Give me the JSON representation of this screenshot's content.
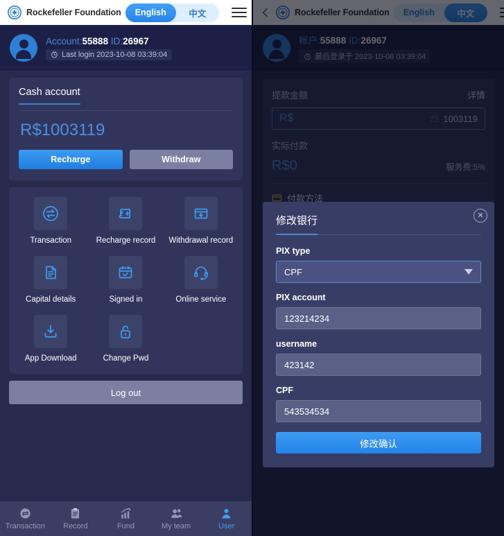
{
  "colors": {
    "panel_bg": "#272a4d",
    "card_bg": "#31355c",
    "accent_blue": "#3d9bf2",
    "text_blue": "#4d8fe0",
    "muted": "#7b80a3",
    "modal_bg": "#383d66"
  },
  "left": {
    "topbar": {
      "brand": "Rockefeller Foundation",
      "logo_icon": "compass-badge-icon",
      "languages": [
        {
          "label": "English",
          "active": true
        },
        {
          "label": "中文",
          "active": false
        }
      ],
      "menu_icon": "hamburger-icon"
    },
    "account": {
      "avatar_icon": "user-avatar-icon",
      "account_label": "Account:",
      "account_value": "55888",
      "id_label": "ID:",
      "id_value": "26967",
      "clock_icon": "clock-icon",
      "last_login": "Last login 2023-10-08 03:39:04"
    },
    "cash_card": {
      "title": "Cash account",
      "balance": "R$1003119",
      "recharge_label": "Recharge",
      "withdraw_label": "Withdraw"
    },
    "grid": [
      {
        "label": "Transaction",
        "icon": "exchange-circle-icon"
      },
      {
        "label": "Recharge record",
        "icon": "wallet-in-icon"
      },
      {
        "label": "Withdrawal record",
        "icon": "card-down-icon"
      },
      {
        "label": "Capital details",
        "icon": "document-lines-icon"
      },
      {
        "label": "Signed in",
        "icon": "calendar-check-icon"
      },
      {
        "label": "Online service",
        "icon": "headset-icon"
      },
      {
        "label": "App Download",
        "icon": "download-tray-icon"
      },
      {
        "label": "Change Pwd",
        "icon": "open-padlock-icon"
      }
    ],
    "logout_label": "Log out",
    "bottom_nav": [
      {
        "label": "Transaction",
        "icon": "exchange-circle-icon",
        "active": false
      },
      {
        "label": "Record",
        "icon": "clipboard-icon",
        "active": false
      },
      {
        "label": "Fund",
        "icon": "bar-chart-up-icon",
        "active": false
      },
      {
        "label": "My team",
        "icon": "people-icon",
        "active": false
      },
      {
        "label": "User",
        "icon": "person-icon",
        "active": true
      }
    ]
  },
  "right": {
    "topbar": {
      "back_icon": "chevron-left-icon",
      "brand": "Rockefeller Foundation",
      "logo_icon": "compass-badge-icon",
      "languages": [
        {
          "label": "English",
          "active": false
        },
        {
          "label": "中文",
          "active": true
        }
      ],
      "menu_icon": "hamburger-icon"
    },
    "account": {
      "avatar_icon": "user-avatar-icon",
      "account_label": "帐户:",
      "account_value": "55888",
      "id_label": "ID:",
      "id_value": "26967",
      "clock_icon": "clock-icon",
      "last_login": "最后登录于 2023-10-08 03:39:04"
    },
    "withdraw": {
      "amount_label": "提款金额",
      "detail_label": "详情",
      "currency_placeholder": "R$",
      "all_icon": "all-balance-icon",
      "all_value": "1003119",
      "actual_label": "实际付款",
      "actual_value": "R$0",
      "fee_label": "服务费:5%",
      "pay_icon": "card-icon",
      "pay_label": "付款方法"
    },
    "modal": {
      "title": "修改银行",
      "close_icon": "close-circle-icon",
      "fields": [
        {
          "label": "PIX type",
          "value": "CPF",
          "type": "select",
          "name": "pix-type"
        },
        {
          "label": "PIX account",
          "value": "123214234",
          "type": "text",
          "name": "pix-account"
        },
        {
          "label": "username",
          "value": "423142",
          "type": "text",
          "name": "username"
        },
        {
          "label": "CPF",
          "value": "543534534",
          "type": "text",
          "name": "cpf"
        }
      ],
      "submit_label": "修改确认"
    }
  }
}
